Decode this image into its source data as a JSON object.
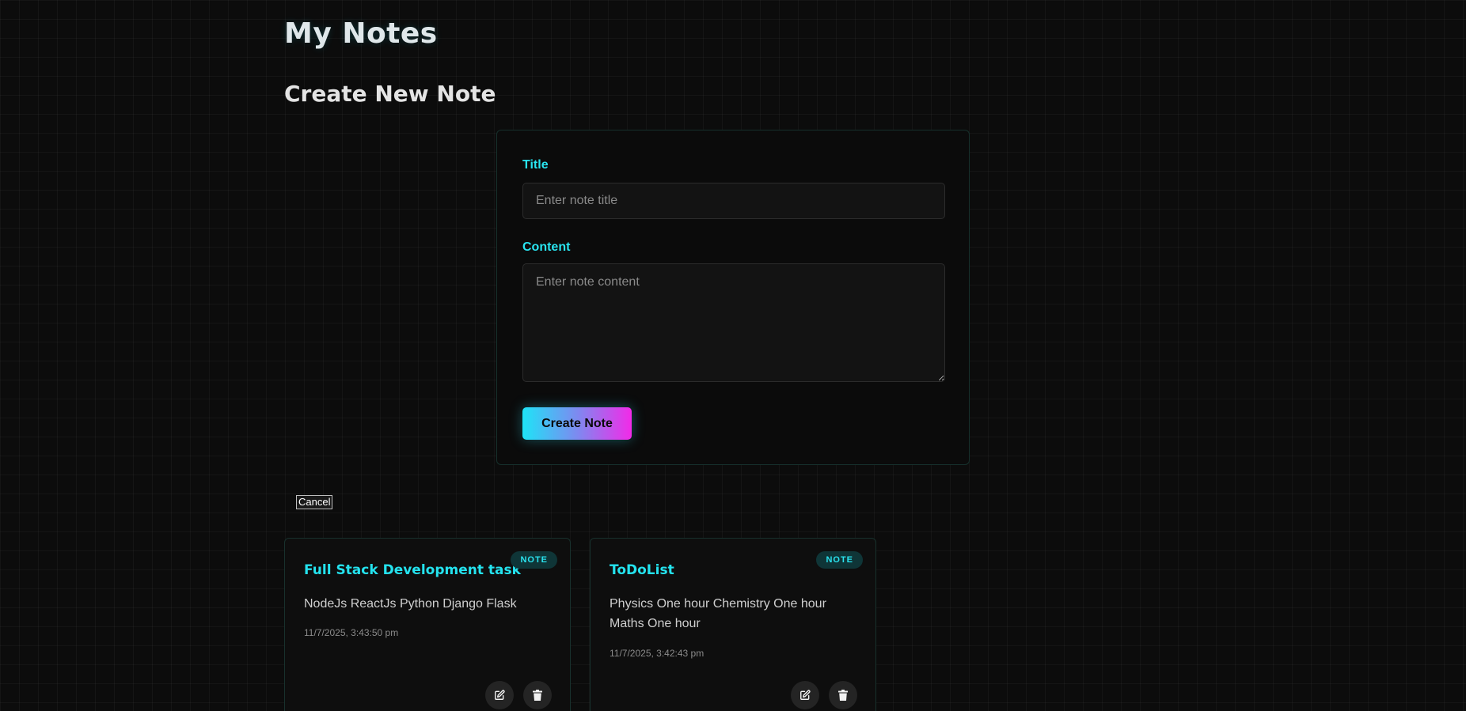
{
  "header": {
    "title": "My Notes"
  },
  "form": {
    "heading": "Create New Note",
    "title_label": "Title",
    "title_placeholder": "Enter note title",
    "title_value": "",
    "content_label": "Content",
    "content_placeholder": "Enter note content",
    "content_value": "",
    "submit_label": "Create Note",
    "cancel_label": "Cancel"
  },
  "notes": [
    {
      "title": "Full Stack Development task",
      "badge": "NOTE",
      "content": "NodeJs ReactJs Python Django Flask",
      "date": "11/7/2025, 3:43:50 pm",
      "edit_icon": "edit-icon",
      "delete_icon": "trash-icon"
    },
    {
      "title": "ToDoList",
      "badge": "NOTE",
      "content": "Physics One hour Chemistry One hour Maths One hour",
      "date": "11/7/2025, 3:42:43 pm",
      "edit_icon": "edit-icon",
      "delete_icon": "trash-icon"
    }
  ],
  "colors": {
    "accent": "#24e3ef",
    "gradient_start": "#1ee4f7",
    "gradient_end": "#f22ae8",
    "background": "#0c0c0c"
  }
}
